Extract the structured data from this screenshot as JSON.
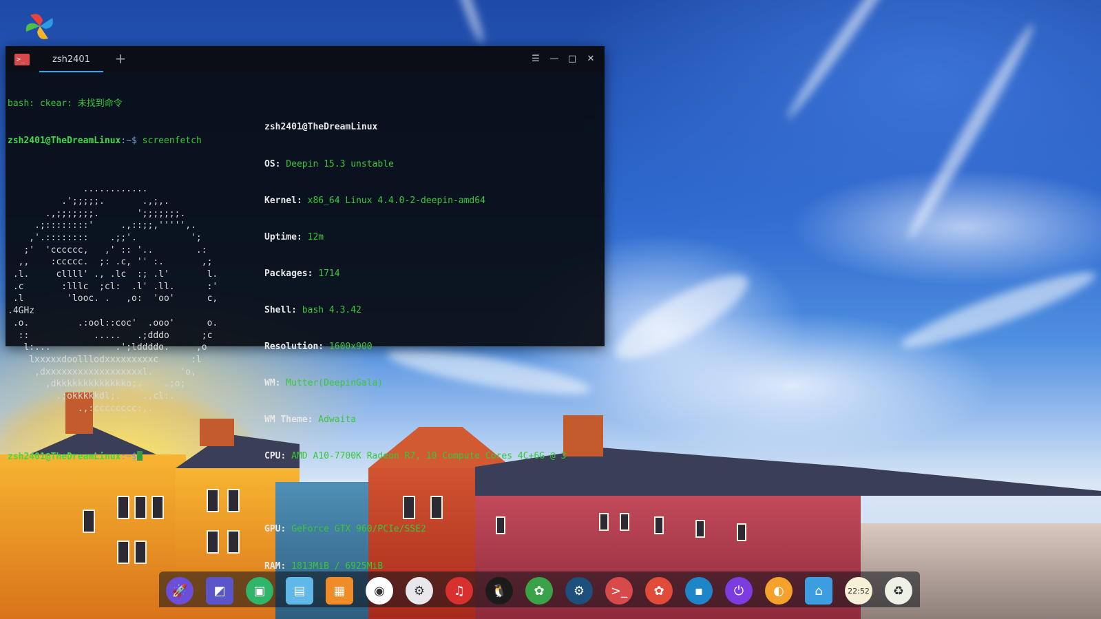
{
  "terminal": {
    "tab_title": "zsh2401",
    "new_tab_glyph": "+",
    "controls": {
      "menu": "☰",
      "minimize": "—",
      "maximize": "□",
      "close": "✕"
    },
    "lines": {
      "error": "bash: ckear: 未找到命令",
      "prompt_user": "zsh2401@TheDreamLinux",
      "prompt_path": ":~$",
      "command": " screenfetch",
      "final_prompt_user": "zsh2401@TheDreamLinux",
      "final_prompt_path": ":~$"
    },
    "ascii_art": [
      "              ............",
      "          .';;;;;.       .,;,.",
      "       .,;;;;;;;.       ';;;;;;;.",
      "     .;::::::::'     .,::;;,''''',.",
      "    ,'.::::::::    .;;'.          ';",
      "   ;'  'cccccc,   ,' :: '..        .:",
      "  ,,    :ccccc.  ;: .c, '' :.       ,;",
      " .l.     cllll' ., .lc  :; .l'       l.",
      " .c       :lllc  ;cl:  .l' .ll.      :'",
      " .l        'looc. .   ,o:  'oo'      c,",
      ".4GHz",
      " .o.         .:ool::coc'  .ooo'      o.",
      "  ::            .....   .;dddo      ;c",
      "   l:...            .';lddddo.     ,o",
      "    lxxxxxdoolllodxxxxxxxxxc      :l",
      "     ,dxxxxxxxxxxxxxxxxxxl.     'o,",
      "       ,dkkkkkkkkkkkkko;.    .;o;",
      "         .;okkkkkdl;.    .,cl:.",
      "             .,:cccccccc:,."
    ],
    "info": {
      "user_host": "zsh2401@TheDreamLinux",
      "os_label": "OS:",
      "os_value": " Deepin 15.3 unstable",
      "kernel_label": "Kernel:",
      "kernel_value": " x86_64 Linux 4.4.0-2-deepin-amd64",
      "uptime_label": "Uptime:",
      "uptime_value": " 12m",
      "packages_label": "Packages:",
      "packages_value": " 1714",
      "shell_label": "Shell:",
      "shell_value": " bash 4.3.42",
      "resolution_label": "Resolution:",
      "resolution_value": " 1600x900",
      "wm_label": "WM:",
      "wm_value": " Mutter(DeepinGala)",
      "wm_theme_label": "WM Theme:",
      "wm_theme_value": " Adwaita",
      "cpu_label": "CPU:",
      "cpu_value": " AMD A10-7700K Radeon R7, 10 Compute Cores 4C+6G @ 3",
      "gpu_label": "GPU:",
      "gpu_value": " GeForce GTX 960/PCIe/SSE2",
      "ram_label": "RAM:",
      "ram_value": " 1813MiB / 6925MiB"
    }
  },
  "dock": {
    "items": [
      {
        "name": "launcher-icon",
        "glyph": "🚀",
        "bg": "#6b4fd8"
      },
      {
        "name": "screenshot-icon",
        "glyph": "◩",
        "bg": "#5a56c9"
      },
      {
        "name": "wps-icon",
        "glyph": "▣",
        "bg": "#2fb46a"
      },
      {
        "name": "file-manager-icon",
        "glyph": "▤",
        "bg": "#5fb8e8"
      },
      {
        "name": "app-store-icon",
        "glyph": "▦",
        "bg": "#f08c28"
      },
      {
        "name": "chrome-icon",
        "glyph": "◉",
        "bg": "#ffffff"
      },
      {
        "name": "settings-icon",
        "glyph": "⚙",
        "bg": "#e8e8ec"
      },
      {
        "name": "netease-music-icon",
        "glyph": "♫",
        "bg": "#d8302f"
      },
      {
        "name": "qq-icon",
        "glyph": "🐧",
        "bg": "#1b1b1b"
      },
      {
        "name": "pinwheel-icon",
        "glyph": "✿",
        "bg": "#3aa34a"
      },
      {
        "name": "steam-icon",
        "glyph": "⚙",
        "bg": "#1d4f7d"
      },
      {
        "name": "terminal-icon",
        "glyph": ">_",
        "bg": "#d84a4a"
      },
      {
        "name": "pinwheel-icon-2",
        "glyph": "✿",
        "bg": "#e24a3a"
      },
      {
        "name": "multitask-icon",
        "glyph": "▪",
        "bg": "#1e86c8"
      },
      {
        "name": "power-icon",
        "glyph": "⏻",
        "bg": "#7c3ce0"
      },
      {
        "name": "browser-icon",
        "glyph": "◐",
        "bg": "#f4a22c"
      },
      {
        "name": "system-monitor-icon",
        "glyph": "⌂",
        "bg": "#3c9ee0"
      },
      {
        "name": "clock-icon",
        "glyph": "22:52",
        "bg": "#f6f0d6"
      },
      {
        "name": "trash-icon",
        "glyph": "♻",
        "bg": "#eef2e6"
      }
    ]
  },
  "colors": {
    "accent": "#2ca7f8",
    "prompt_green": "#42d84a",
    "terminal_bg": "#080c12"
  }
}
